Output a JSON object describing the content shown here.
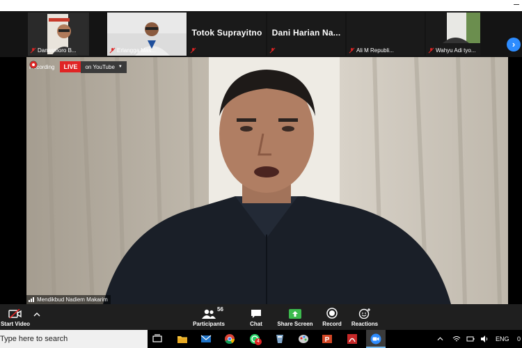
{
  "window": {
    "title": ""
  },
  "gallery": {
    "tiles": [
      {
        "name": "Danasmoro B...",
        "type": "video"
      },
      {
        "name": "Erlangga Mas...",
        "type": "video"
      },
      {
        "name": "Totok Suprayitno",
        "type": "name"
      },
      {
        "name": "Dani  Harian  Na...",
        "type": "name"
      },
      {
        "name": "Ali M Republi...",
        "type": "name"
      },
      {
        "name": "Wahyu Adi tyo...",
        "type": "video"
      }
    ],
    "next_icon": "chevron-right-icon"
  },
  "stage": {
    "recording_label": "Recording",
    "live_label": "LIVE",
    "stream_target": "on YouTube",
    "speaker_name": "Mendikbud Nadiem Makarim"
  },
  "toolbar": {
    "start_video": "Start Video",
    "participants": "Participants",
    "participants_count": "56",
    "chat": "Chat",
    "share_screen": "Share Screen",
    "record": "Record",
    "reactions": "Reactions",
    "share_color": "#3dba4e",
    "live_color": "#e02424",
    "accent_color": "#2d8cff"
  },
  "taskbar": {
    "search_text": "Type here to search",
    "whatsapp_badge": "4",
    "language": "ENG",
    "clock_partial": "0"
  }
}
